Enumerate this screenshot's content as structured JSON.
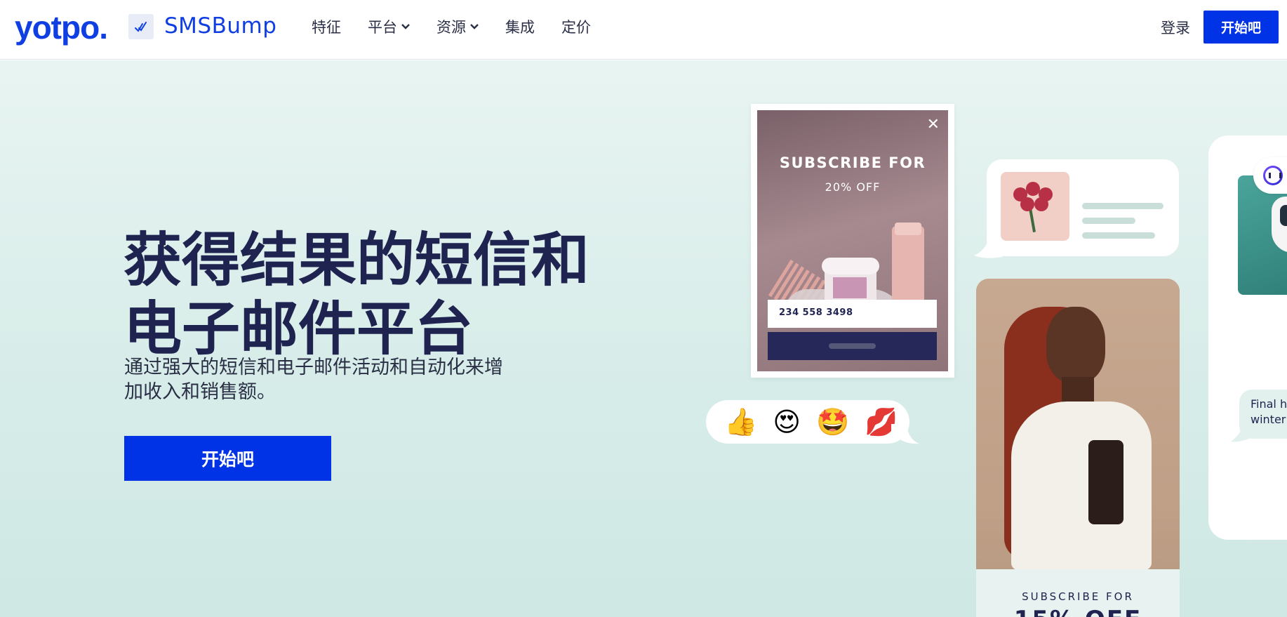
{
  "header": {
    "logo_text": "yotpo.",
    "product_name": "SMSBump",
    "nav": [
      {
        "label": "特征",
        "dropdown": false
      },
      {
        "label": "平台",
        "dropdown": true
      },
      {
        "label": "资源",
        "dropdown": true
      },
      {
        "label": "集成",
        "dropdown": false
      },
      {
        "label": "定价",
        "dropdown": false
      }
    ],
    "login_label": "登录",
    "start_label": "开始吧"
  },
  "hero": {
    "headline_line1": "获得结果的短信和",
    "headline_line2": "电子邮件平台",
    "subtext_line1": "通过强大的短信和电子邮件活动和自动化来增",
    "subtext_line2": "加收入和销售额。",
    "cta_label": "开始吧"
  },
  "popup": {
    "close_glyph": "✕",
    "title": "SUBSCRIBE FOR",
    "discount": "20% OFF",
    "phone_value": "234 558 3498"
  },
  "emojis": [
    "👍",
    "😍",
    "🤩",
    "💋"
  ],
  "woman_card": {
    "subscribe_label": "SUBSCRIBE FOR",
    "discount": "15% OFF"
  },
  "right_phone": {
    "message_line1": "Final h",
    "message_line2": "winter"
  },
  "colors": {
    "brand_blue": "#0032e6",
    "navy": "#1f2350",
    "hero_bg": "#d6ece8"
  }
}
